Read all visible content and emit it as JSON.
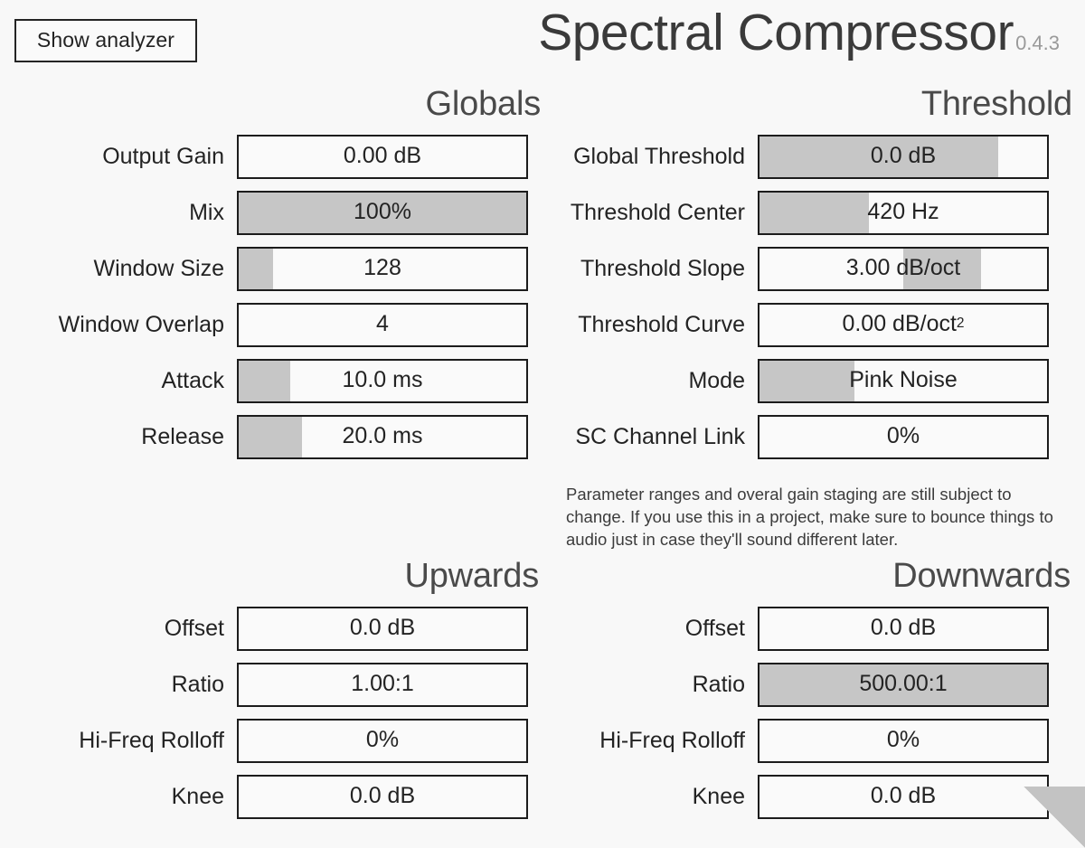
{
  "header": {
    "analyzer_button": "Show analyzer",
    "title": "Spectral Compressor",
    "version": "0.4.3"
  },
  "note": "Parameter ranges and overal gain staging are still subject to change. If you use this in a project, make sure to bounce things to audio just in case they'll sound different later.",
  "colors": {
    "background": "#f8f8f8",
    "border": "#1c1c1c",
    "slider_fill": "#c6c6c6",
    "title": "#3a3a3a",
    "version": "#9a9a9a",
    "panel_title": "#4a4a4a",
    "text": "#232323"
  },
  "panels": {
    "globals": {
      "title": "Globals",
      "params": [
        {
          "label": "Output Gain",
          "value": "0.00 dB",
          "fill_start": 0,
          "fill_end": 0
        },
        {
          "label": "Mix",
          "value": "100%",
          "fill_start": 0,
          "fill_end": 100
        },
        {
          "label": "Window Size",
          "value": "128",
          "fill_start": 0,
          "fill_end": 12
        },
        {
          "label": "Window Overlap",
          "value": "4",
          "fill_start": 0,
          "fill_end": 0
        },
        {
          "label": "Attack",
          "value": "10.0 ms",
          "fill_start": 0,
          "fill_end": 18
        },
        {
          "label": "Release",
          "value": "20.0 ms",
          "fill_start": 0,
          "fill_end": 22
        }
      ]
    },
    "threshold": {
      "title": "Threshold",
      "params": [
        {
          "label": "Global Threshold",
          "value": "0.0 dB",
          "fill_start": 0,
          "fill_end": 83
        },
        {
          "label": "Threshold Center",
          "value": "420 Hz",
          "fill_start": 0,
          "fill_end": 38
        },
        {
          "label": "Threshold Slope",
          "value": "3.00 dB/oct",
          "fill_start": 50,
          "fill_end": 77
        },
        {
          "label": "Threshold Curve",
          "value": "0.00 dB/oct²",
          "fill_start": 0,
          "fill_end": 0
        },
        {
          "label": "Mode",
          "value": "Pink Noise",
          "fill_start": 0,
          "fill_end": 33
        },
        {
          "label": "SC Channel Link",
          "value": "0%",
          "fill_start": 0,
          "fill_end": 0
        }
      ]
    },
    "upwards": {
      "title": "Upwards",
      "params": [
        {
          "label": "Offset",
          "value": "0.0 dB",
          "fill_start": 0,
          "fill_end": 0
        },
        {
          "label": "Ratio",
          "value": "1.00:1",
          "fill_start": 0,
          "fill_end": 0
        },
        {
          "label": "Hi-Freq Rolloff",
          "value": "0%",
          "fill_start": 0,
          "fill_end": 0
        },
        {
          "label": "Knee",
          "value": "0.0 dB",
          "fill_start": 0,
          "fill_end": 0
        }
      ]
    },
    "downwards": {
      "title": "Downwards",
      "params": [
        {
          "label": "Offset",
          "value": "0.0 dB",
          "fill_start": 0,
          "fill_end": 0
        },
        {
          "label": "Ratio",
          "value": "500.00:1",
          "fill_start": 0,
          "fill_end": 100
        },
        {
          "label": "Hi-Freq Rolloff",
          "value": "0%",
          "fill_start": 0,
          "fill_end": 0
        },
        {
          "label": "Knee",
          "value": "0.0 dB",
          "fill_start": 0,
          "fill_end": 0
        }
      ]
    }
  }
}
